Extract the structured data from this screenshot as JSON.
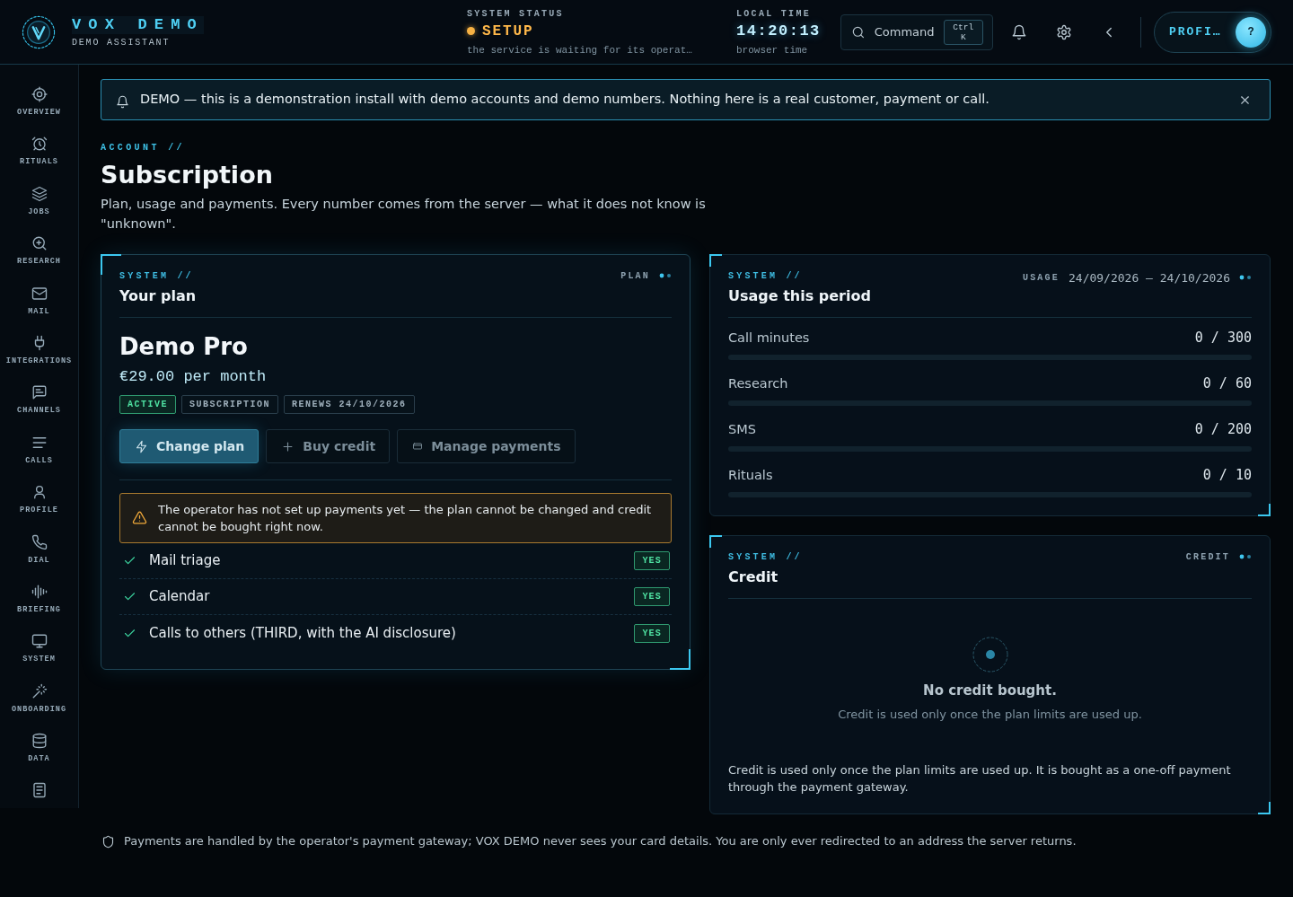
{
  "header": {
    "brand": {
      "title": "VOX DEMO",
      "subtitle": "DEMO ASSISTANT"
    },
    "system_status": {
      "label": "SYSTEM STATUS",
      "value": "SETUP",
      "detail": "the service is waiting for its operat…"
    },
    "local_time": {
      "label": "LOCAL TIME",
      "value": "14:20:13",
      "detail": "browser time"
    },
    "command": {
      "label": "Command",
      "shortcut": "Ctrl K"
    },
    "profile": {
      "label": "PROFI…",
      "avatar": "?"
    }
  },
  "sidebar": {
    "items": [
      {
        "label": "OVERVIEW",
        "selected": false
      },
      {
        "label": "RITUALS",
        "selected": false
      },
      {
        "label": "JOBS",
        "selected": false
      },
      {
        "label": "RESEARCH",
        "selected": false
      },
      {
        "label": "MAIL",
        "selected": false
      },
      {
        "label": "INTEGRATIONS",
        "selected": false
      },
      {
        "label": "CHANNELS",
        "selected": false
      },
      {
        "label": "CALLS",
        "selected": false
      },
      {
        "label": "PROFILE",
        "selected": false
      },
      {
        "label": "DIAL",
        "selected": false
      },
      {
        "label": "BRIEFING",
        "selected": false
      },
      {
        "label": "SYSTEM",
        "selected": false
      },
      {
        "label": "ONBOARDING",
        "selected": false
      },
      {
        "label": "DATA",
        "selected": false
      },
      {
        "selected": false
      }
    ]
  },
  "banner": {
    "text": "DEMO — this is a demonstration install with demo accounts and demo numbers. Nothing here is a real customer, payment or call."
  },
  "page": {
    "kicker": "ACCOUNT //",
    "title": "Subscription",
    "description": "Plan, usage and payments. Every number comes from the server — what it does not know is \"unknown\"."
  },
  "plan_card": {
    "highlighted": true,
    "kicker": "SYSTEM //",
    "title": "Your plan",
    "tag": "PLAN",
    "plan_name": "Demo Pro",
    "price": "€29.00 per month",
    "badges": [
      {
        "label": "ACTIVE",
        "kind": "success"
      },
      {
        "label": "SUBSCRIPTION",
        "kind": "neutral"
      },
      {
        "label": "RENEWS 24/10/2026",
        "kind": "neutral"
      }
    ],
    "buttons": [
      {
        "label": "Change plan",
        "kind": "primary"
      },
      {
        "label": "Buy credit",
        "kind": "secondary"
      },
      {
        "label": "Manage payments",
        "kind": "secondary"
      }
    ],
    "warning": "The operator has not set up payments yet — the plan cannot be changed and credit cannot be bought right now.",
    "features": [
      {
        "label": "Mail triage",
        "included": true,
        "badge": "YES"
      },
      {
        "label": "Calendar",
        "included": true,
        "badge": "YES"
      },
      {
        "label": "Calls to others (THIRD, with the AI disclosure)",
        "included": true,
        "badge": "YES"
      }
    ]
  },
  "usage_card": {
    "highlighted": false,
    "kicker": "SYSTEM //",
    "title": "Usage this period",
    "tag": "USAGE",
    "period": "24/09/2026 – 24/10/2026",
    "meters": [
      {
        "label": "Call minutes",
        "reading": "0 / 300",
        "level": 0
      },
      {
        "label": "Research",
        "reading": "0 / 60",
        "level": 0
      },
      {
        "label": "SMS",
        "reading": "0 / 200",
        "level": 0
      },
      {
        "label": "Rituals",
        "reading": "0 / 10",
        "level": 0
      }
    ]
  },
  "credit_card": {
    "highlighted": false,
    "kicker": "SYSTEM //",
    "title": "Credit",
    "tag": "CREDIT",
    "empty_title": "No credit bought.",
    "empty_text": "Credit is used only once the plan limits are used up.",
    "note": "Credit is used only once the plan limits are used up. It is bought as a one-off payment through the payment gateway."
  },
  "footer_note": {
    "text": "Payments are handled by the operator's payment gateway; VOX DEMO never sees your card details. You are only ever redirected to an address the server returns."
  }
}
